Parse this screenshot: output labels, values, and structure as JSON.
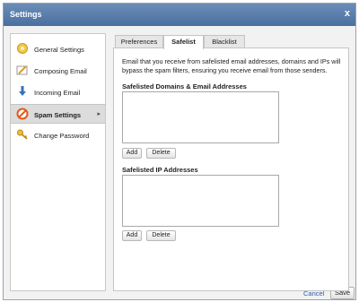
{
  "window": {
    "title": "Settings",
    "close_glyph": "x"
  },
  "sidebar": {
    "items": [
      {
        "label": "General Settings",
        "icon": "gear-icon",
        "active": false
      },
      {
        "label": "Composing Email",
        "icon": "compose-icon",
        "active": false
      },
      {
        "label": "Incoming Email",
        "icon": "incoming-icon",
        "active": false
      },
      {
        "label": "Spam Settings",
        "icon": "no-spam-icon",
        "active": true
      },
      {
        "label": "Change Password",
        "icon": "key-icon",
        "active": false
      }
    ],
    "active_arrow": "▸"
  },
  "tabs": [
    {
      "label": "Preferences",
      "active": false
    },
    {
      "label": "Safelist",
      "active": true
    },
    {
      "label": "Blacklist",
      "active": false
    }
  ],
  "safelist": {
    "description": "Email that you receive from safelisted email addresses, domains and IPs will bypass the spam filters, ensuring you receive email from those senders.",
    "domains": {
      "heading": "Safelisted Domains & Email Addresses",
      "add_label": "Add",
      "delete_label": "Delete"
    },
    "ips": {
      "heading": "Safelisted IP Addresses",
      "add_label": "Add",
      "delete_label": "Delete"
    }
  },
  "footer": {
    "cancel_label": "Cancel",
    "save_label": "Save"
  },
  "colors": {
    "titlebar": "#5a7fb0",
    "link": "#2a5aa8"
  }
}
